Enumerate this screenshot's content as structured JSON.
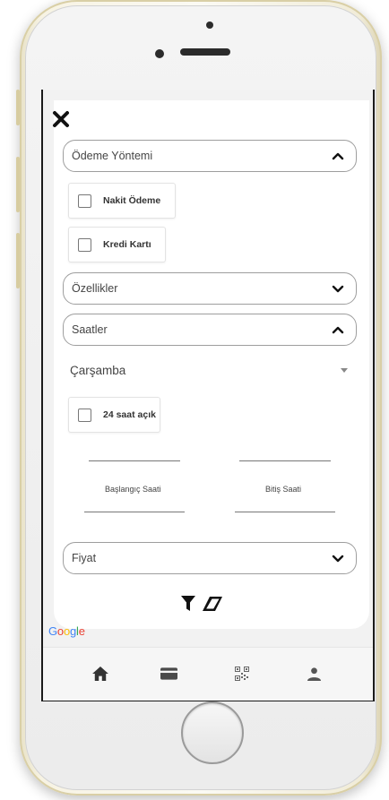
{
  "filter": {
    "payment": {
      "title": "Ödeme Yöntemi",
      "expanded": true,
      "options": [
        "Nakit Ödeme",
        "Kredi Kartı"
      ]
    },
    "features": {
      "title": "Özellikler",
      "expanded": false
    },
    "hours": {
      "title": "Saatler",
      "expanded": true,
      "day": "Çarşamba",
      "open24": "24 saat açık",
      "start_label": "Başlangıç Saati",
      "end_label": "Bitiş Saati"
    },
    "price": {
      "title": "Fiyat",
      "expanded": false
    }
  },
  "branding": {
    "google": [
      "G",
      "o",
      "o",
      "g",
      "l",
      "e"
    ]
  },
  "icons": {
    "close": "close-icon",
    "filter": "funnel-icon",
    "clear": "eraser-icon",
    "tabs": [
      "home-icon",
      "card-icon",
      "qr-code-icon",
      "user-icon"
    ]
  },
  "colors": {
    "google_blue": "#4285F4",
    "google_red": "#EA4335",
    "google_yellow": "#FBBC05",
    "google_green": "#34A853",
    "icon_dark": "#1a1a1a",
    "tab_icon": "#4a4a4a"
  }
}
